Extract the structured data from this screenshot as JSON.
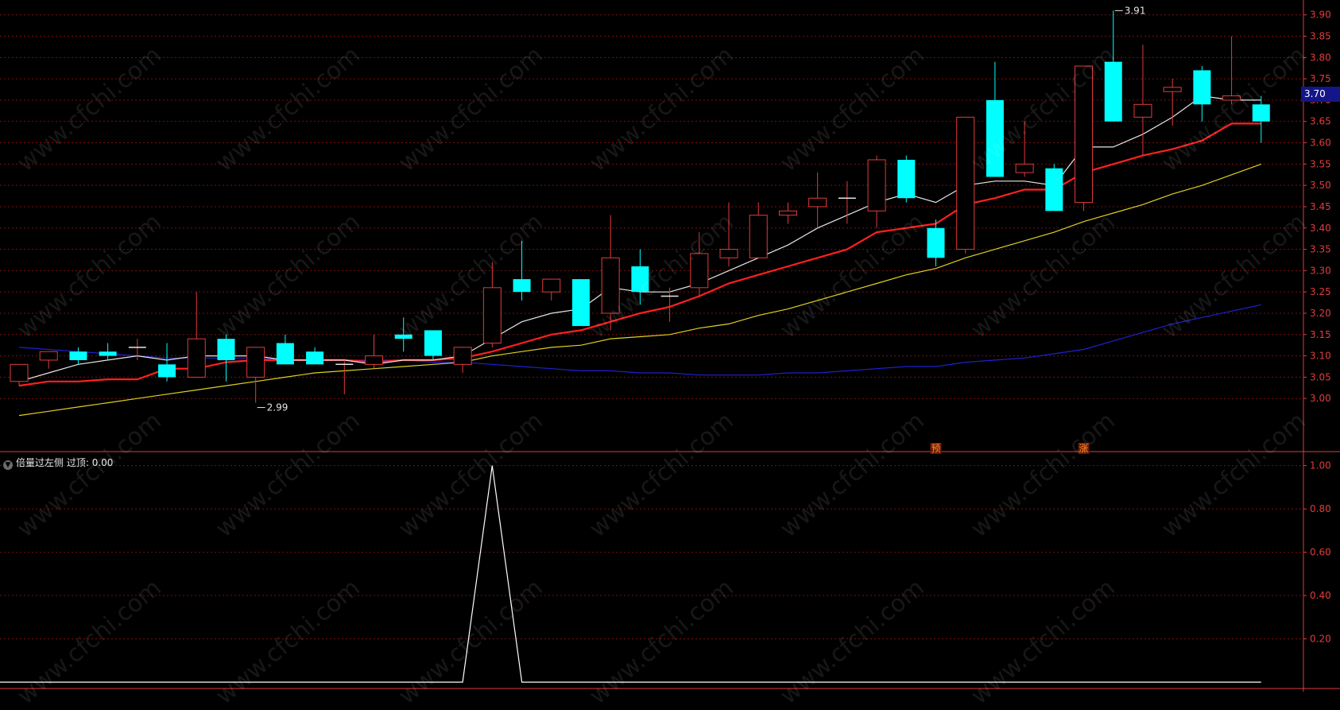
{
  "watermark_text": "www.cfchi.com",
  "colors": {
    "up": "#e23b3b",
    "down": "#00ffff",
    "axis": "#e23b3b",
    "ma5": "#e6e6e6",
    "ma10": "#ff2020",
    "ma20": "#e0d020",
    "ma60": "#2020d0",
    "indicator": "#ffffff"
  },
  "indicator": {
    "title": "倍量过左侧",
    "param_label": "过顶:",
    "param_value": "0.00"
  },
  "last_price_label": "3.70",
  "chart_data": [
    {
      "type": "candlestick",
      "ylim": [
        2.95,
        3.92
      ],
      "y_ticks": [
        "3.00",
        "3.05",
        "3.10",
        "3.15",
        "3.20",
        "3.25",
        "3.30",
        "3.35",
        "3.40",
        "3.45",
        "3.50",
        "3.55",
        "3.60",
        "3.65",
        "3.70",
        "3.75",
        "3.80",
        "3.85",
        "3.90"
      ],
      "candles": [
        {
          "o": 3.04,
          "h": 3.08,
          "l": 3.03,
          "c": 3.08
        },
        {
          "o": 3.09,
          "h": 3.11,
          "l": 3.07,
          "c": 3.11
        },
        {
          "o": 3.11,
          "h": 3.12,
          "l": 3.08,
          "c": 3.09
        },
        {
          "o": 3.11,
          "h": 3.13,
          "l": 3.09,
          "c": 3.1
        },
        {
          "o": 3.12,
          "h": 3.14,
          "l": 3.09,
          "c": 3.12
        },
        {
          "o": 3.08,
          "h": 3.13,
          "l": 3.04,
          "c": 3.05
        },
        {
          "o": 3.05,
          "h": 3.25,
          "l": 3.05,
          "c": 3.14
        },
        {
          "o": 3.14,
          "h": 3.15,
          "l": 3.04,
          "c": 3.09
        },
        {
          "o": 3.05,
          "h": 3.12,
          "l": 2.99,
          "c": 3.12
        },
        {
          "o": 3.13,
          "h": 3.15,
          "l": 3.08,
          "c": 3.08
        },
        {
          "o": 3.11,
          "h": 3.12,
          "l": 3.08,
          "c": 3.08
        },
        {
          "o": 3.08,
          "h": 3.09,
          "l": 3.01,
          "c": 3.08
        },
        {
          "o": 3.08,
          "h": 3.15,
          "l": 3.07,
          "c": 3.1
        },
        {
          "o": 3.15,
          "h": 3.19,
          "l": 3.11,
          "c": 3.14
        },
        {
          "o": 3.16,
          "h": 3.16,
          "l": 3.09,
          "c": 3.1
        },
        {
          "o": 3.08,
          "h": 3.12,
          "l": 3.06,
          "c": 3.12
        },
        {
          "o": 3.13,
          "h": 3.32,
          "l": 3.12,
          "c": 3.26
        },
        {
          "o": 3.28,
          "h": 3.37,
          "l": 3.23,
          "c": 3.25
        },
        {
          "o": 3.25,
          "h": 3.28,
          "l": 3.23,
          "c": 3.28
        },
        {
          "o": 3.28,
          "h": 3.28,
          "l": 3.17,
          "c": 3.17
        },
        {
          "o": 3.2,
          "h": 3.43,
          "l": 3.16,
          "c": 3.33
        },
        {
          "o": 3.31,
          "h": 3.35,
          "l": 3.22,
          "c": 3.25
        },
        {
          "o": 3.24,
          "h": 3.26,
          "l": 3.18,
          "c": 3.24
        },
        {
          "o": 3.26,
          "h": 3.39,
          "l": 3.24,
          "c": 3.34
        },
        {
          "o": 3.33,
          "h": 3.46,
          "l": 3.31,
          "c": 3.35
        },
        {
          "o": 3.33,
          "h": 3.46,
          "l": 3.33,
          "c": 3.43
        },
        {
          "o": 3.43,
          "h": 3.46,
          "l": 3.41,
          "c": 3.44
        },
        {
          "o": 3.45,
          "h": 3.53,
          "l": 3.4,
          "c": 3.47
        },
        {
          "o": 3.47,
          "h": 3.51,
          "l": 3.41,
          "c": 3.47
        },
        {
          "o": 3.44,
          "h": 3.57,
          "l": 3.4,
          "c": 3.56
        },
        {
          "o": 3.56,
          "h": 3.57,
          "l": 3.46,
          "c": 3.47
        },
        {
          "o": 3.4,
          "h": 3.42,
          "l": 3.31,
          "c": 3.33
        },
        {
          "o": 3.35,
          "h": 3.66,
          "l": 3.34,
          "c": 3.66
        },
        {
          "o": 3.7,
          "h": 3.79,
          "l": 3.52,
          "c": 3.52
        },
        {
          "o": 3.53,
          "h": 3.65,
          "l": 3.52,
          "c": 3.55
        },
        {
          "o": 3.54,
          "h": 3.55,
          "l": 3.44,
          "c": 3.44
        },
        {
          "o": 3.46,
          "h": 3.78,
          "l": 3.44,
          "c": 3.78
        },
        {
          "o": 3.79,
          "h": 3.91,
          "l": 3.65,
          "c": 3.65
        },
        {
          "o": 3.66,
          "h": 3.83,
          "l": 3.57,
          "c": 3.69
        },
        {
          "o": 3.72,
          "h": 3.75,
          "l": 3.64,
          "c": 3.73
        },
        {
          "o": 3.77,
          "h": 3.78,
          "l": 3.65,
          "c": 3.69
        },
        {
          "o": 3.7,
          "h": 3.85,
          "l": 3.69,
          "c": 3.71
        },
        {
          "o": 3.69,
          "h": 3.71,
          "l": 3.6,
          "c": 3.65
        }
      ],
      "ma5": [
        3.04,
        3.06,
        3.08,
        3.09,
        3.1,
        3.09,
        3.1,
        3.1,
        3.1,
        3.09,
        3.09,
        3.09,
        3.08,
        3.09,
        3.09,
        3.1,
        3.14,
        3.18,
        3.2,
        3.21,
        3.26,
        3.25,
        3.25,
        3.27,
        3.3,
        3.33,
        3.36,
        3.4,
        3.43,
        3.46,
        3.48,
        3.46,
        3.5,
        3.51,
        3.51,
        3.5,
        3.59,
        3.59,
        3.62,
        3.66,
        3.71,
        3.7,
        3.7
      ],
      "ma10": [
        3.03,
        3.04,
        3.04,
        3.045,
        3.045,
        3.07,
        3.07,
        3.085,
        3.09,
        3.09,
        3.09,
        3.09,
        3.085,
        3.09,
        3.09,
        3.095,
        3.11,
        3.13,
        3.15,
        3.16,
        3.18,
        3.2,
        3.215,
        3.24,
        3.27,
        3.29,
        3.31,
        3.33,
        3.35,
        3.39,
        3.4,
        3.41,
        3.455,
        3.47,
        3.49,
        3.49,
        3.53,
        3.55,
        3.57,
        3.585,
        3.605,
        3.645,
        3.645
      ],
      "ma20": [
        2.96,
        2.97,
        2.98,
        2.99,
        3.0,
        3.01,
        3.02,
        3.03,
        3.04,
        3.05,
        3.06,
        3.065,
        3.07,
        3.075,
        3.08,
        3.085,
        3.1,
        3.11,
        3.12,
        3.125,
        3.14,
        3.145,
        3.15,
        3.165,
        3.175,
        3.195,
        3.21,
        3.23,
        3.25,
        3.27,
        3.29,
        3.305,
        3.33,
        3.35,
        3.37,
        3.39,
        3.415,
        3.435,
        3.455,
        3.48,
        3.5,
        3.525,
        3.55
      ],
      "ma60": [
        3.12,
        3.115,
        3.11,
        3.105,
        3.1,
        3.095,
        3.095,
        3.095,
        3.095,
        3.09,
        3.09,
        3.09,
        3.09,
        3.09,
        3.085,
        3.085,
        3.08,
        3.075,
        3.07,
        3.065,
        3.065,
        3.06,
        3.06,
        3.055,
        3.055,
        3.055,
        3.06,
        3.06,
        3.065,
        3.07,
        3.075,
        3.075,
        3.085,
        3.09,
        3.095,
        3.105,
        3.115,
        3.135,
        3.155,
        3.175,
        3.19,
        3.205,
        3.22
      ],
      "annotations": [
        {
          "index": 8,
          "text": "2.99",
          "price": 2.99
        },
        {
          "index": 37,
          "text": "3.91",
          "price": 3.91
        }
      ],
      "signals": [
        {
          "index": 31,
          "text": "预"
        },
        {
          "index": 36,
          "text": "涨"
        }
      ]
    },
    {
      "type": "line",
      "name": "倍量过左侧",
      "ylim": [
        0,
        1.05
      ],
      "y_ticks": [
        "0.20",
        "0.40",
        "0.60",
        "0.80",
        "1.00"
      ],
      "values": [
        0,
        0,
        0,
        0,
        0,
        0,
        0,
        0,
        0,
        0,
        0,
        0,
        0,
        0,
        0,
        0,
        1,
        0,
        0,
        0,
        0,
        0,
        0,
        0,
        0,
        0,
        0,
        0,
        0,
        0,
        0,
        0,
        0,
        0,
        0,
        0,
        0,
        0,
        0,
        0,
        0,
        0,
        0
      ]
    }
  ]
}
